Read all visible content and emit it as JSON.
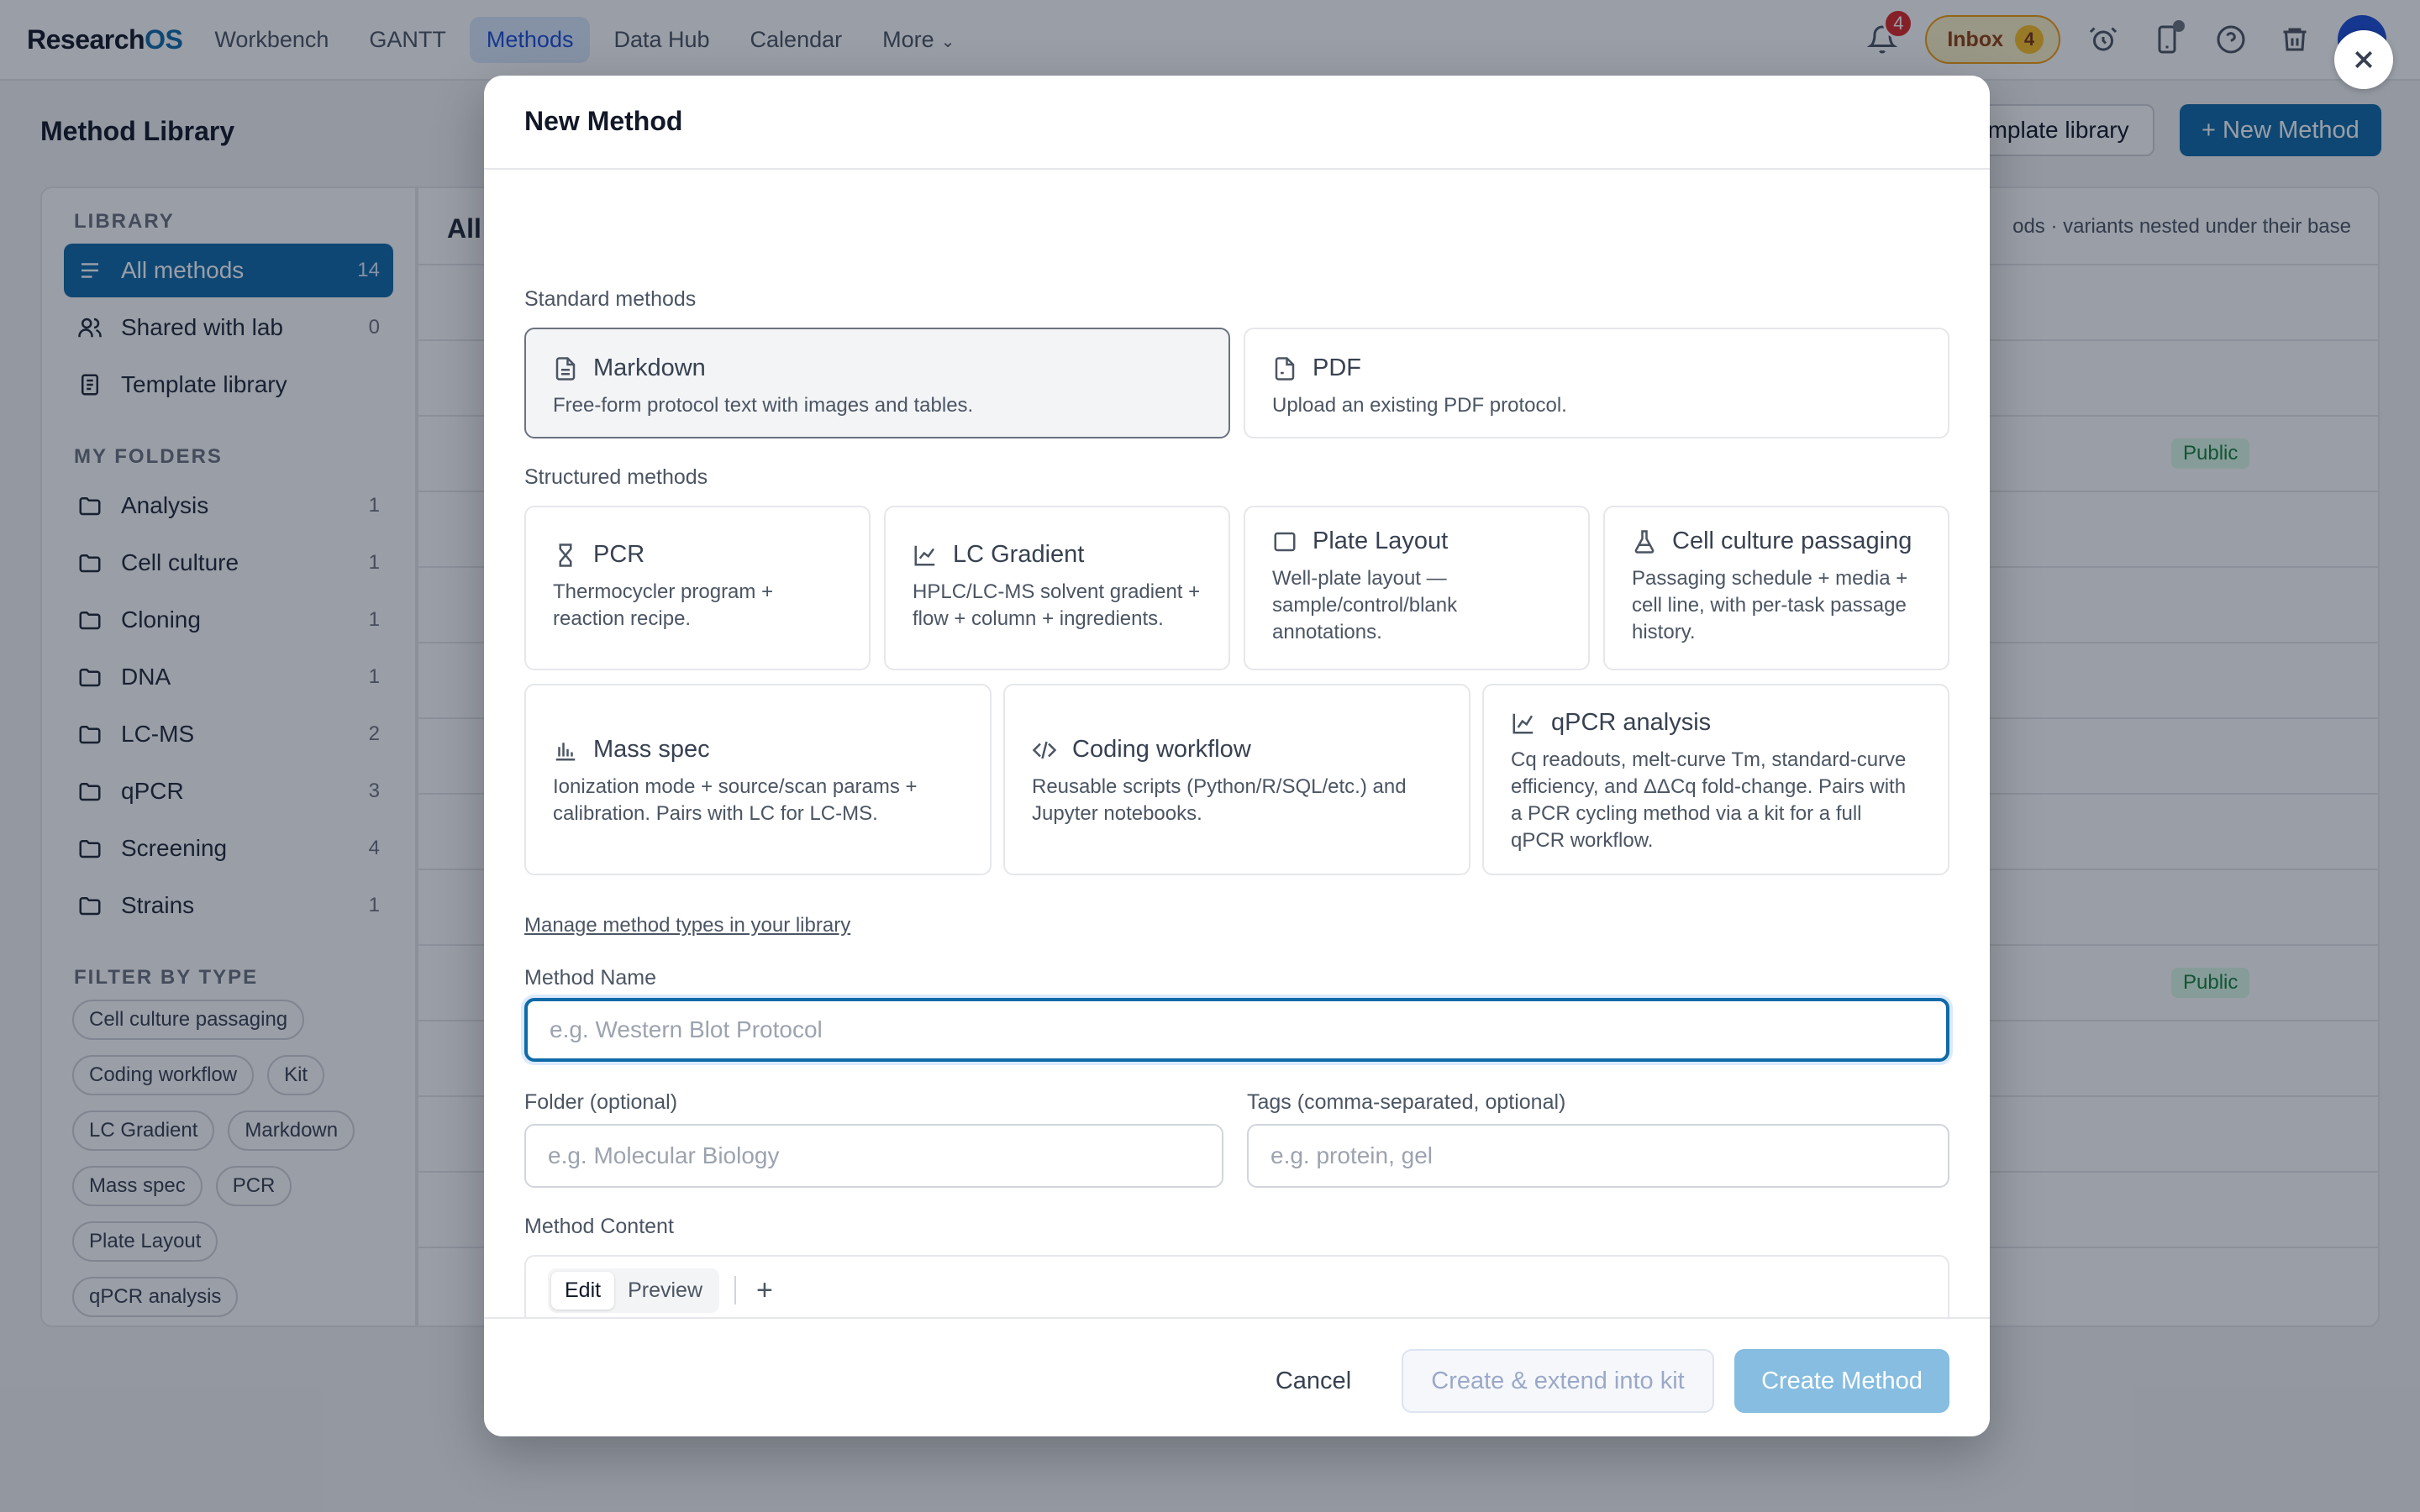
{
  "nav": {
    "brand_main": "Research",
    "brand_accent": "OS",
    "tabs": [
      {
        "label": "Workbench"
      },
      {
        "label": "GANTT"
      },
      {
        "label": "Methods"
      },
      {
        "label": "Data Hub"
      },
      {
        "label": "Calendar"
      },
      {
        "label": "More"
      }
    ],
    "notifications_count": "4",
    "inbox_label": "Inbox",
    "inbox_count": "4",
    "icons": [
      "bell-icon",
      "alarm-icon",
      "phone-icon",
      "help-icon",
      "trash-icon"
    ]
  },
  "page": {
    "title": "Method Library",
    "template_library_button": "emplate library",
    "new_method_button": "+ New Method"
  },
  "sidebar": {
    "library_heading": "LIBRARY",
    "library_items": [
      {
        "label": "All methods",
        "count": "14"
      },
      {
        "label": "Shared with lab",
        "count": "0"
      },
      {
        "label": "Template library",
        "count": ""
      }
    ],
    "folders_heading": "MY FOLDERS",
    "folders": [
      {
        "label": "Analysis",
        "count": "1"
      },
      {
        "label": "Cell culture",
        "count": "1"
      },
      {
        "label": "Cloning",
        "count": "1"
      },
      {
        "label": "DNA",
        "count": "1"
      },
      {
        "label": "LC-MS",
        "count": "2"
      },
      {
        "label": "qPCR",
        "count": "3"
      },
      {
        "label": "Screening",
        "count": "4"
      },
      {
        "label": "Strains",
        "count": "1"
      }
    ],
    "filter_heading": "FILTER BY TYPE",
    "filter_chips": [
      "Cell culture passaging",
      "Coding workflow",
      "Kit",
      "LC Gradient",
      "Markdown",
      "Mass spec",
      "PCR",
      "Plate Layout",
      "qPCR analysis"
    ]
  },
  "main": {
    "heading": "All",
    "subtitle": "ods · variants nested under their base",
    "public_badge": "Public"
  },
  "modal": {
    "title": "New Method",
    "standard_label": "Standard methods",
    "standard": [
      {
        "title": "Markdown",
        "desc": "Free-form protocol text with images and tables."
      },
      {
        "title": "PDF",
        "desc": "Upload an existing PDF protocol."
      }
    ],
    "structured_label": "Structured methods",
    "structured": [
      {
        "title": "PCR",
        "desc": "Thermocycler program + reaction recipe."
      },
      {
        "title": "LC Gradient",
        "desc": "HPLC/LC-MS solvent gradient + flow + column + ingredients."
      },
      {
        "title": "Plate Layout",
        "desc": "Well-plate layout — sample/control/blank annotations."
      },
      {
        "title": "Cell culture passaging",
        "desc": "Passaging schedule + media + cell line, with per-task passage history."
      },
      {
        "title": "Mass spec",
        "desc": "Ionization mode + source/scan params + calibration. Pairs with LC for LC-MS."
      },
      {
        "title": "Coding workflow",
        "desc": "Reusable scripts (Python/R/SQL/etc.) and Jupyter notebooks."
      },
      {
        "title": "qPCR analysis",
        "desc": "Cq readouts, melt-curve Tm, standard-curve efficiency, and ΔΔCq fold-change. Pairs with a PCR cycling method via a kit for a full qPCR workflow."
      }
    ],
    "manage_link": "Manage method types in your library",
    "name_label": "Method Name",
    "name_placeholder": "e.g. Western Blot Protocol",
    "folder_label": "Folder (optional)",
    "folder_placeholder": "e.g. Molecular Biology",
    "tags_label": "Tags (comma-separated, optional)",
    "tags_placeholder": "e.g. protein, gel",
    "content_label": "Method Content",
    "editor_tabs": [
      "Edit",
      "Preview"
    ],
    "editor_add": "+",
    "cancel": "Cancel",
    "create_kit": "Create & extend into kit",
    "create": "Create Method"
  }
}
